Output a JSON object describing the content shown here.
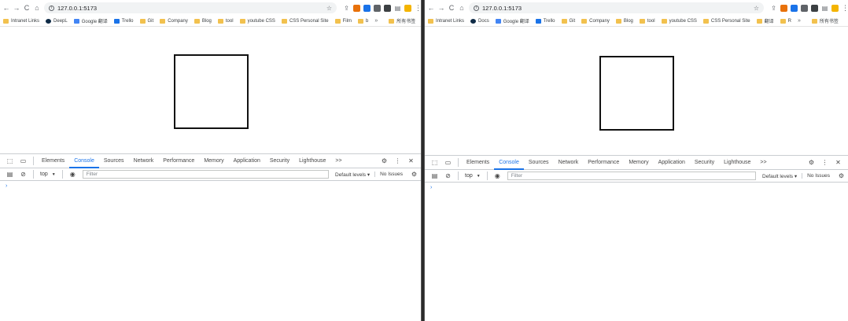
{
  "windows": [
    {
      "id": "left",
      "address": "127.0.0.1:5173",
      "bookmarks": [
        "Intranet Links",
        "DeepL",
        "Google 翻译",
        "Trello",
        "Git",
        "Company",
        "Blog",
        "tool",
        "youtube CSS",
        "CSS Personal Site",
        "Film",
        "b"
      ],
      "bookmarks_overflow": "»",
      "bookmarks_last": "所有书签",
      "devtools": {
        "tabs": [
          "Elements",
          "Console",
          "Sources",
          "Network",
          "Performance",
          "Memory",
          "Application",
          "Security",
          "Lighthouse"
        ],
        "active_tab": "Console",
        "more_tabs": ">>",
        "context": "top",
        "filter_placeholder": "Filter",
        "levels": "Default levels ▾",
        "issues": "No Issues",
        "prompt": "›"
      }
    },
    {
      "id": "right",
      "address": "127.0.0.1:5173",
      "bookmarks": [
        "Intranet Links",
        "Docs",
        "Google 翻译",
        "Trello",
        "Git",
        "Company",
        "Blog",
        "tool",
        "youtube CSS",
        "CSS Personal Site",
        "翻译",
        "R"
      ],
      "bookmarks_overflow": "»",
      "bookmarks_last": "所有书签",
      "devtools": {
        "tabs": [
          "Elements",
          "Console",
          "Sources",
          "Network",
          "Performance",
          "Memory",
          "Application",
          "Security",
          "Lighthouse"
        ],
        "active_tab": "Console",
        "more_tabs": ">>",
        "context": "top",
        "filter_placeholder": "Filter",
        "levels": "Default levels ▾",
        "issues": "No Issues",
        "prompt": "›"
      }
    }
  ],
  "icons": {
    "back": "←",
    "forward": "→",
    "reload": "C",
    "home": "⌂",
    "star": "☆",
    "share": "⇪",
    "inspect": "⬚",
    "device": "▭",
    "sidebar": "▤",
    "clear": "⊘",
    "eye": "◉",
    "gear": "⚙",
    "kebab": "⋮",
    "close": "✕"
  },
  "colors": {
    "accent": "#1a73e8"
  }
}
